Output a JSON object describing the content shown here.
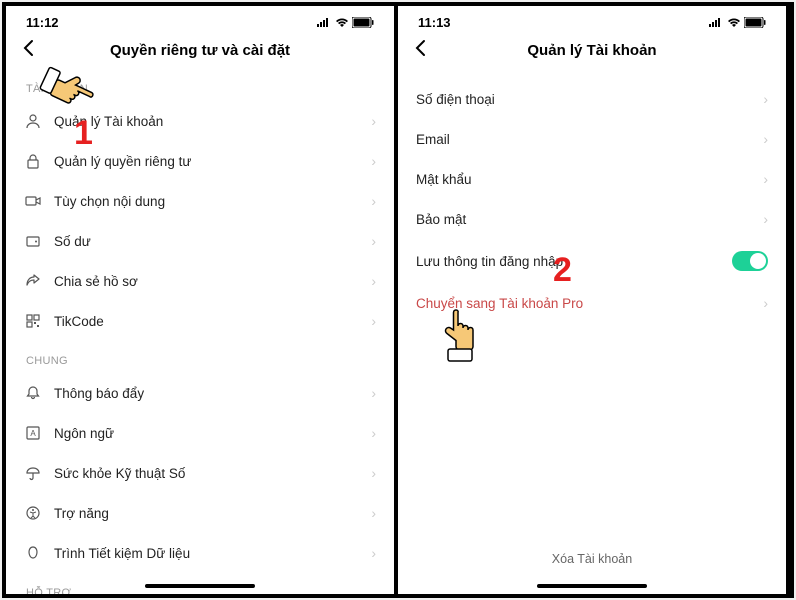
{
  "phone1": {
    "status_time": "11:12",
    "nav_title": "Quyền riêng tư và cài đặt",
    "sections": {
      "account": {
        "header": "TÀI KHOẢN",
        "items": [
          {
            "label": "Quản lý Tài khoản"
          },
          {
            "label": "Quản lý quyền riêng tư"
          },
          {
            "label": "Tùy chọn nội dung"
          },
          {
            "label": "Số dư"
          },
          {
            "label": "Chia sẻ hồ sơ"
          },
          {
            "label": "TikCode"
          }
        ]
      },
      "general": {
        "header": "CHUNG",
        "items": [
          {
            "label": "Thông báo đẩy"
          },
          {
            "label": "Ngôn ngữ"
          },
          {
            "label": "Sức khỏe Kỹ thuật Số"
          },
          {
            "label": "Trợ năng"
          },
          {
            "label": "Trình Tiết kiệm Dữ liệu"
          }
        ]
      },
      "support": {
        "header": "HỖ TRỢ"
      }
    },
    "annotation_number": "1"
  },
  "phone2": {
    "status_time": "11:13",
    "nav_title": "Quản lý Tài khoản",
    "items": [
      {
        "label": "Số điện thoại"
      },
      {
        "label": "Email"
      },
      {
        "label": "Mật khẩu"
      },
      {
        "label": "Bảo mật"
      },
      {
        "label": "Lưu thông tin đăng nhập",
        "toggle": true
      },
      {
        "label": "Chuyển sang Tài khoản Pro",
        "accent": true
      }
    ],
    "delete_label": "Xóa Tài khoản",
    "annotation_number": "2"
  }
}
